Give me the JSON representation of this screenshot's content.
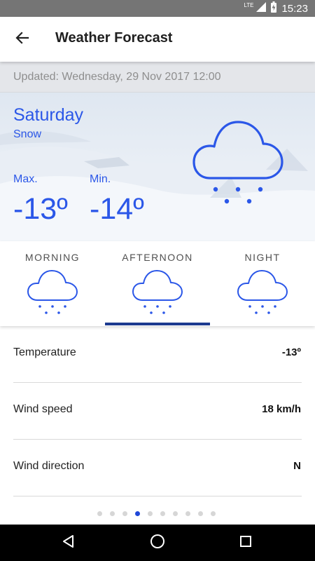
{
  "status_bar": {
    "network": "LTE",
    "time": "15:23"
  },
  "toolbar": {
    "title": "Weather Forecast",
    "back_icon": "arrow-back-icon"
  },
  "updated_text": "Updated: Wednesday, 29 Nov 2017 12:00",
  "forecast": {
    "day": "Saturday",
    "condition": "Snow",
    "max_label": "Max.",
    "max_value": "-13º",
    "min_label": "Min.",
    "min_value": "-14º",
    "icon": "snow-cloud-icon"
  },
  "tabs": [
    {
      "label": "MORNING",
      "icon": "snow-cloud-icon"
    },
    {
      "label": "AFTERNOON",
      "icon": "snow-cloud-icon",
      "selected": true
    },
    {
      "label": "NIGHT",
      "icon": "snow-cloud-icon"
    }
  ],
  "details": [
    {
      "label": "Temperature",
      "value": "-13º"
    },
    {
      "label": "Wind speed",
      "value": "18 km/h"
    },
    {
      "label": "Wind direction",
      "value": "N"
    }
  ],
  "page_indicator": {
    "count": 10,
    "active_index": 3
  },
  "colors": {
    "accent": "#2b57e8",
    "tab_indicator": "#1c3a8f",
    "status_bar": "#757575",
    "nav_bar": "#000000"
  }
}
